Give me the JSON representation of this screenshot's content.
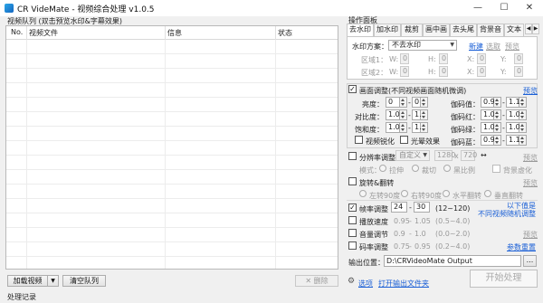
{
  "window": {
    "title": "CR VideMate - 视频综合处理 v1.0.5",
    "minimize": "—",
    "maximize": "☐",
    "close": "✕"
  },
  "queue": {
    "label": "视频队列 (双击预览水印&字幕效果)",
    "columns": [
      "No.",
      "视频文件",
      "信息",
      "状态"
    ]
  },
  "bottom_buttons": {
    "load": "加载视频",
    "load_dropdown": "▼",
    "clear": "清空队列",
    "delete": "删除"
  },
  "log_label": "处理记录",
  "ops": {
    "label": "操作面板",
    "tabs": [
      "去水印",
      "加水印",
      "裁剪",
      "画中画",
      "去头尾",
      "背景音",
      "文本"
    ],
    "active_tab": "去水印",
    "watermark": {
      "scheme_label": "水印方案：",
      "scheme_value": "不去水印",
      "new": "新建",
      "pick": "选取",
      "preview": "预览",
      "area1": "区域1：",
      "area2": "区域2：",
      "w": "W:",
      "h": "H:",
      "x": "X:",
      "y": "Y:",
      "zero": "0"
    },
    "adjust": {
      "enabled_label": "画面调整(不同视频画面随机微调)",
      "preview": "预览",
      "brightness": "亮度：",
      "contrast": "对比度：",
      "saturation": "饱和度：",
      "gamma": "伽码值：",
      "gamma_red": "伽码红：",
      "gamma_green": "伽码绿：",
      "gamma_blue": "伽码蓝：",
      "b_min": "0",
      "b_max": "0",
      "c_min": "1.0",
      "c_max": "1.0",
      "s_min": "1.0",
      "s_max": "1.0",
      "g_min": "0.9",
      "g_max": "1.1",
      "gr_min": "1.0",
      "gr_max": "1.0",
      "gg_min": "1.0",
      "gg_max": "1.0",
      "gb_min": "0.9",
      "gb_max": "1.1",
      "dash": "-",
      "sharpen": "视频锐化",
      "light": "光晕效果"
    },
    "resolution": {
      "label": "分辨率调整",
      "mode": "自定义",
      "w": "1280",
      "x": "x",
      "h": "720",
      "swap": "↔",
      "preview": "预览",
      "mode_label": "模式：",
      "stretch": "拉伸",
      "crop": "裁切",
      "black": "黑比例",
      "blur": "背景虚化"
    },
    "rotate": {
      "label": "旋转&翻转",
      "preview": "预览",
      "left90": "左转90度",
      "right90": "右转90度",
      "hflip": "水平翻转",
      "vflip": "垂直翻转"
    },
    "framerate": {
      "label": "帧率调整",
      "min": "24",
      "max": "30",
      "range": "(12~120)",
      "dash": "-"
    },
    "tip": {
      "line1": "以下值是",
      "line2": "不同视频随机调整"
    },
    "speed": {
      "label": "播放速度",
      "min": "0.95",
      "max": "1.05",
      "range": "(0.5~4.0)",
      "dash": "-"
    },
    "volume": {
      "label": "音量调节",
      "min": "0.9",
      "max": "1.0",
      "range": "(0.0~2.0)",
      "dash": "-",
      "preview": "预览"
    },
    "bitrate": {
      "label": "码率调整",
      "min": "0.75",
      "max": "0.95",
      "range": "(0.2~4.0)",
      "dash": "-",
      "reset": "参数重置"
    },
    "output": {
      "label": "输出位置：",
      "path": "D:\\CRVideoMate Output",
      "browse": "..."
    },
    "options": "选项",
    "open_folder": "打开输出文件夹",
    "start": "开始处理"
  },
  "colors": {
    "link": "#1a5fd6",
    "disabled": "#999999"
  }
}
